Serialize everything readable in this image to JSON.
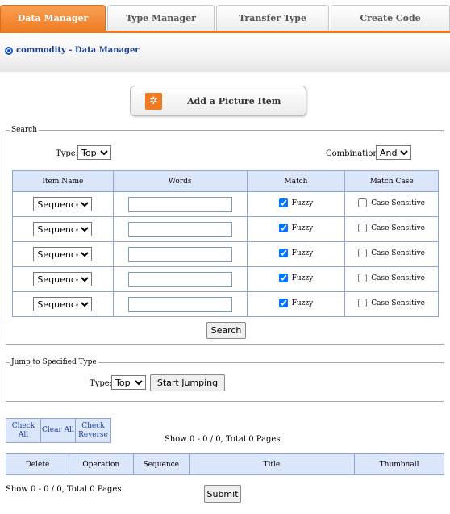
{
  "tabs": [
    {
      "label": "Data Manager",
      "active": true
    },
    {
      "label": "Type Manager",
      "active": false
    },
    {
      "label": "Transfer Type",
      "active": false
    },
    {
      "label": "Create Code",
      "active": false
    }
  ],
  "colors": {
    "accent": "#ef7a22",
    "link": "#1b3f95",
    "grid_header": "#dbe6fb",
    "grid_border": "#8ea5d2"
  },
  "breadcrumb": "commodity - Data Manager",
  "add_picture": {
    "label": "Add a Picture Item",
    "icon": "add-picture-icon"
  },
  "search": {
    "legend": "Search",
    "type_label": "Type:",
    "type_value": "Top",
    "combination_label": "Combination:",
    "combination_value": "And",
    "columns": [
      "Item Name",
      "Words",
      "Match",
      "Match Case"
    ],
    "rows": [
      {
        "item": "Sequence",
        "words": "",
        "fuzzy_label": "Fuzzy",
        "fuzzy": true,
        "case_label": "Case Sensitive",
        "case": false
      },
      {
        "item": "Sequence",
        "words": "",
        "fuzzy_label": "Fuzzy",
        "fuzzy": true,
        "case_label": "Case Sensitive",
        "case": false
      },
      {
        "item": "Sequence",
        "words": "",
        "fuzzy_label": "Fuzzy",
        "fuzzy": true,
        "case_label": "Case Sensitive",
        "case": false
      },
      {
        "item": "Sequence",
        "words": "",
        "fuzzy_label": "Fuzzy",
        "fuzzy": true,
        "case_label": "Case Sensitive",
        "case": false
      },
      {
        "item": "Sequence",
        "words": "",
        "fuzzy_label": "Fuzzy",
        "fuzzy": true,
        "case_label": "Case Sensitive",
        "case": false
      }
    ],
    "button": "Search"
  },
  "jump": {
    "legend": "Jump to Specified Type",
    "type_label": "Type:",
    "type_value": "Top",
    "button": "Start Jumping"
  },
  "controls": {
    "check_all": "Check All",
    "clear_all": "Clear All",
    "check_reverse": "Check Reverse"
  },
  "paging_top": "Show 0 - 0 / 0, Total 0 Pages",
  "results_columns": [
    "Delete",
    "Operation",
    "Sequence",
    "Title",
    "Thumbnail"
  ],
  "paging_bottom": "Show 0 - 0 / 0, Total 0 Pages",
  "submit": "Submit"
}
